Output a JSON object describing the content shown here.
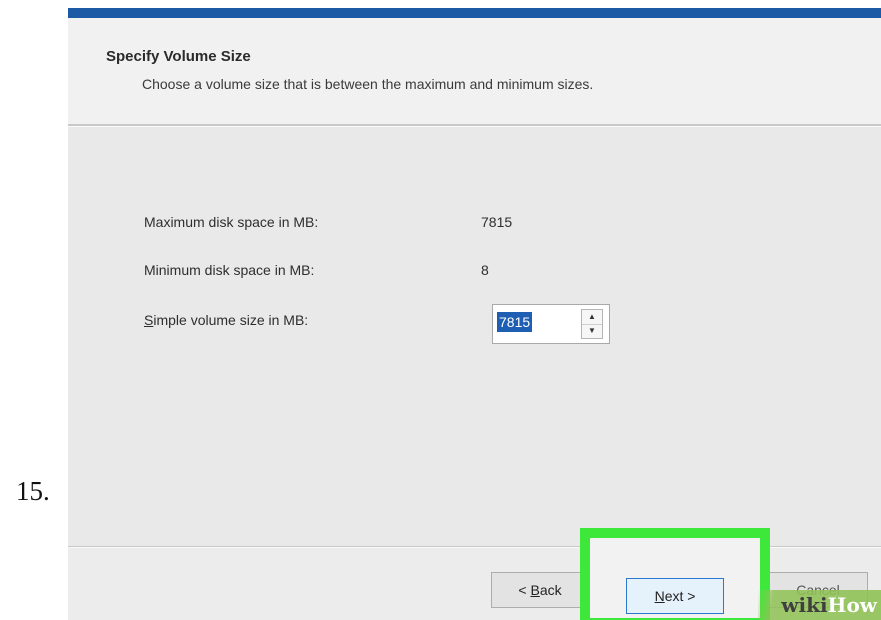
{
  "step_number": "15.",
  "header": {
    "title": "Specify Volume Size",
    "subtitle": "Choose a volume size that is between the maximum and minimum sizes."
  },
  "fields": {
    "max_label": "Maximum disk space in MB:",
    "max_value": "7815",
    "min_label": "Minimum disk space in MB:",
    "min_value": "8",
    "size_label_mnemonic": "S",
    "size_label_rest": "imple volume size in MB:",
    "size_value": "7815"
  },
  "buttons": {
    "back_prefix": "< ",
    "back_mnemonic": "B",
    "back_rest": "ack",
    "next_mnemonic": "N",
    "next_rest": "ext >",
    "cancel_label": "Cancel"
  },
  "watermark": {
    "part1": "wiki",
    "part2": "How"
  },
  "colors": {
    "title_bar": "#1d5aa6",
    "highlight": "#3ee83a",
    "selection": "#1e5fb4",
    "watermark_green": "#8fc255"
  }
}
